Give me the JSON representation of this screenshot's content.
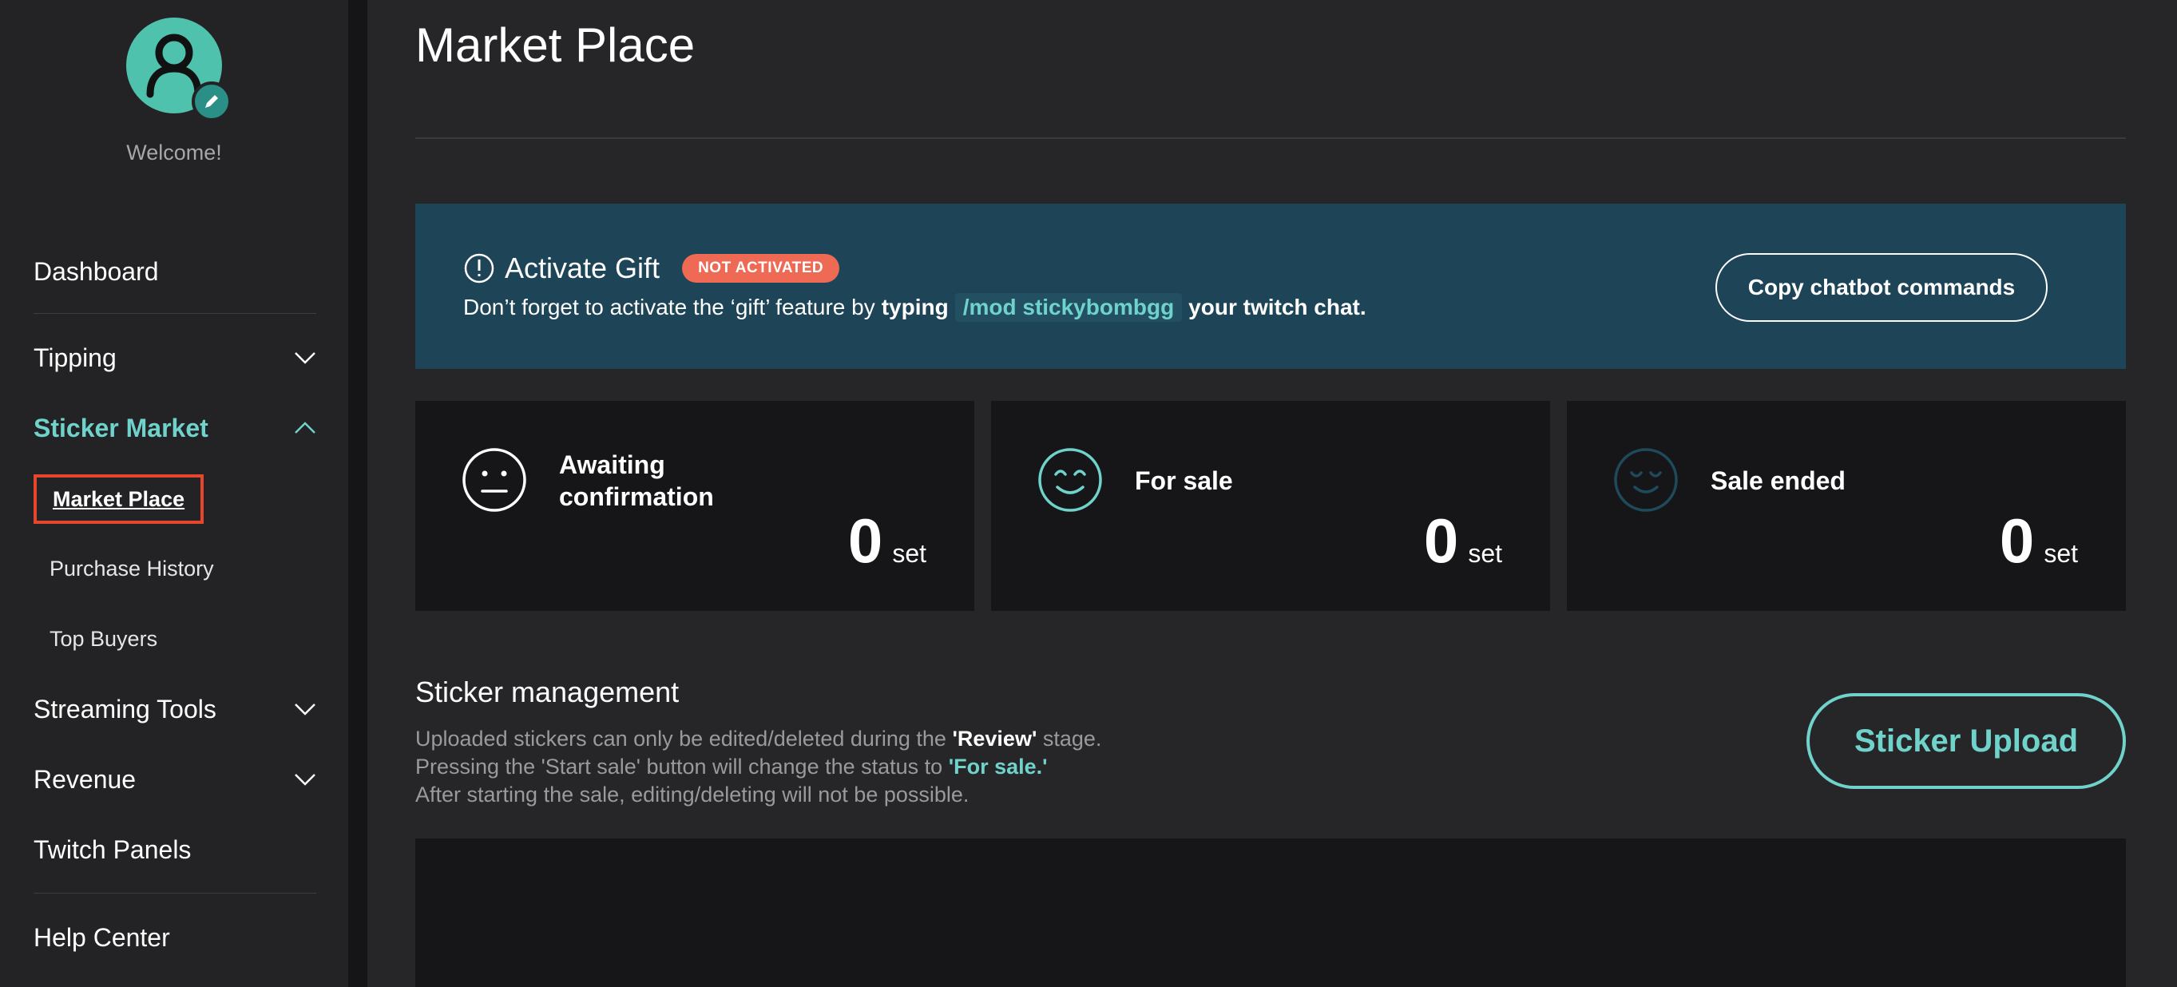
{
  "sidebar": {
    "welcome": "Welcome!",
    "items": {
      "dashboard": "Dashboard",
      "tipping": "Tipping",
      "sticker_market": "Sticker Market",
      "streaming_tools": "Streaming Tools",
      "revenue": "Revenue",
      "twitch_panels": "Twitch Panels",
      "help_center": "Help Center"
    },
    "sub_items": {
      "market_place": "Market Place",
      "purchase_history": "Purchase History",
      "top_buyers": "Top Buyers"
    }
  },
  "main": {
    "title": "Market Place",
    "gift": {
      "title": "Activate Gift",
      "badge": "NOT ACTIVATED",
      "desc_prefix": "Don’t forget to activate the ‘gift’ feature by",
      "desc_typing": "typing",
      "command": "/mod stickybombgg",
      "desc_suffix": "your twitch chat.",
      "copy_button": "Copy chatbot commands"
    },
    "stats": [
      {
        "label": "Awaiting confirmation",
        "value": "0",
        "unit": "set",
        "icon": "neutral-face-icon"
      },
      {
        "label": "For sale",
        "value": "0",
        "unit": "set",
        "icon": "smile-face-icon"
      },
      {
        "label": "Sale ended",
        "value": "0",
        "unit": "set",
        "icon": "content-face-icon"
      }
    ],
    "management": {
      "title": "Sticker management",
      "line1_prefix": "Uploaded stickers can only be edited/deleted during the",
      "line1_bold": "'Review'",
      "line1_suffix": "stage.",
      "line2_prefix": "Pressing the 'Start sale' button will change the status to",
      "line2_teal": "'For sale.'",
      "line3": "After starting the sale, editing/deleting will not be possible.",
      "upload_button": "Sticker Upload"
    }
  },
  "colors": {
    "accent": "#6fd3cb",
    "avatar": "#4fc2ad",
    "banner": "#1d4457",
    "badge": "#ee6a54",
    "highlight_border": "#e4472d"
  }
}
